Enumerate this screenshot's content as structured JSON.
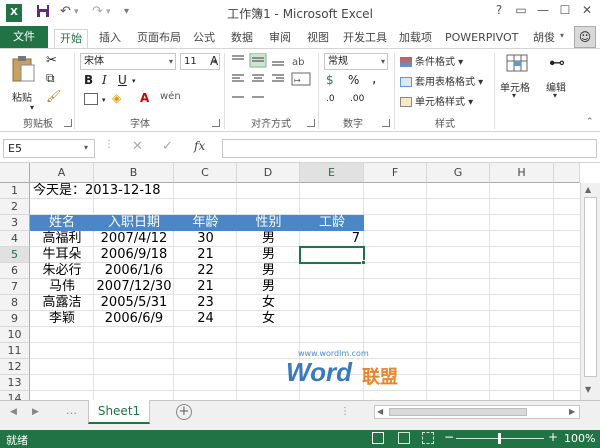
{
  "titlebar": {
    "title": "工作簿1 - Microsoft Excel",
    "qa_icons": [
      "excel-logo-icon",
      "save-icon",
      "undo-icon",
      "redo-icon",
      "customize-icon"
    ],
    "win_buttons": [
      "?",
      "▭",
      "—",
      "☐",
      "✕"
    ]
  },
  "tabs": [
    "插入",
    "页面布局",
    "公式",
    "数据",
    "审阅",
    "视图",
    "开发工具",
    "加载项",
    "POWERPIVOT"
  ],
  "file_tab": "文件",
  "home_tab": "开始",
  "user": "胡俊",
  "ribbon": {
    "clipboard": {
      "paste": "粘贴",
      "label": "剪贴板"
    },
    "font": {
      "name": "宋体",
      "size": "11",
      "bold": "B",
      "italic": "I",
      "underline": "U",
      "grow": "A",
      "shrink": "A",
      "label": "字体",
      "wen": "wén"
    },
    "alignment": {
      "label": "对齐方式"
    },
    "number": {
      "format": "常规",
      "percent": "%",
      "comma": ",",
      "label": "数字",
      "inc": ".0",
      "dec": ".00",
      "currency": "$"
    },
    "styles": {
      "conditional": "条件格式",
      "table": "套用表格格式",
      "cell": "单元格样式",
      "label": "样式"
    },
    "cells": {
      "label": "单元格"
    },
    "editing": {
      "label": "编辑"
    }
  },
  "formula_bar": {
    "name_box": "E5",
    "fx": "fx",
    "content": ""
  },
  "columns": [
    "A",
    "B",
    "C",
    "D",
    "E",
    "F",
    "G",
    "H"
  ],
  "rows": [
    "1",
    "2",
    "3",
    "4",
    "5",
    "6",
    "7",
    "8",
    "9",
    "10",
    "11",
    "12",
    "13",
    "14"
  ],
  "sheet": {
    "a1": "今天是：2013-12-18",
    "headers": [
      "姓名",
      "入职日期",
      "年龄",
      "性别",
      "工龄"
    ],
    "data": [
      [
        "高福利",
        "2007/4/12",
        "30",
        "男",
        "7"
      ],
      [
        "牛耳朵",
        "2006/9/18",
        "21",
        "男",
        ""
      ],
      [
        "朱必行",
        "2006/1/6",
        "22",
        "男",
        ""
      ],
      [
        "马伟",
        "2007/12/30",
        "21",
        "男",
        ""
      ],
      [
        "高露洁",
        "2005/5/31",
        "23",
        "女",
        ""
      ],
      [
        "李颖",
        "2006/6/9",
        "24",
        "女",
        ""
      ]
    ],
    "active_cell": "E5"
  },
  "watermark": {
    "url": "www.wordlm.com",
    "word": "Word",
    "brand": "联盟"
  },
  "sheet_tabs": {
    "name": "Sheet1",
    "add": "+"
  },
  "status": {
    "ready": "就绪",
    "zoom": "100%",
    "minus": "−",
    "plus": "+"
  },
  "colors": {
    "accent": "#217346",
    "header_fill": "#4a86c8"
  }
}
